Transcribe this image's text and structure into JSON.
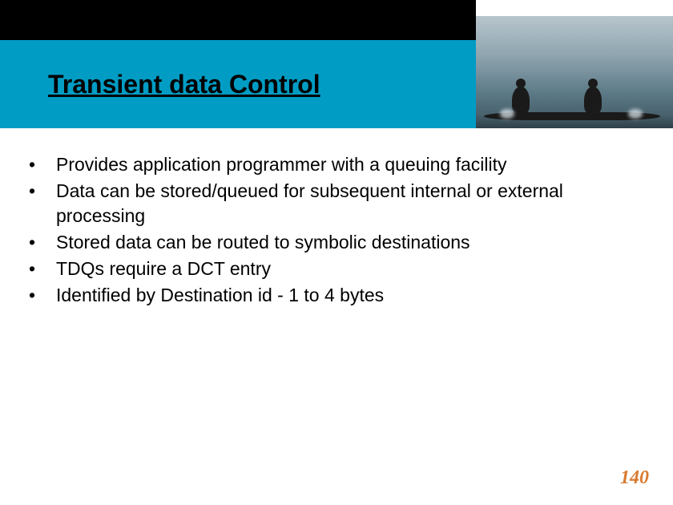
{
  "title": "Transient data Control",
  "bullets": [
    "Provides application programmer with a queuing facility",
    "Data can be stored/queued for subsequent internal or external processing",
    "Stored data can be routed to symbolic destinations",
    "TDQs require a DCT entry",
    "Identified by Destination id - 1 to 4 bytes"
  ],
  "page_number": "140"
}
